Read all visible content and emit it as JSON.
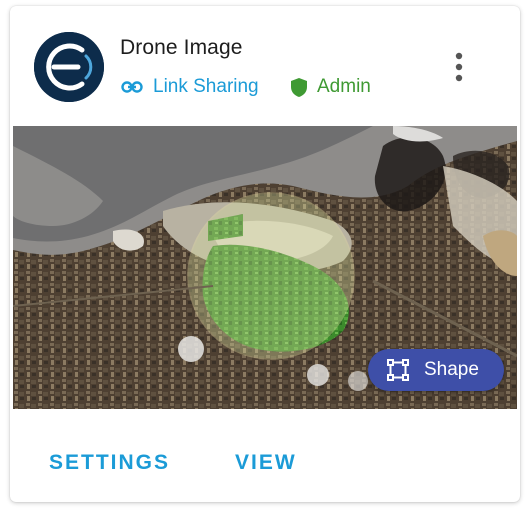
{
  "card": {
    "title": "Drone Image",
    "avatar_icon": "app-logo-e-icon",
    "link_sharing": {
      "icon": "link-icon",
      "label": "Link Sharing",
      "color": "#1b9bd7"
    },
    "role": {
      "icon": "shield-icon",
      "label": "Admin",
      "color": "#3f9a33"
    },
    "menu_icon": "more-vertical-icon"
  },
  "media": {
    "content": "satellite-map",
    "overlay_color": "#3fae2a",
    "shape_button": {
      "icon": "polygon-shape-icon",
      "label": "Shape",
      "color": "#3e4fa8"
    }
  },
  "actions": {
    "settings_label": "SETTINGS",
    "view_label": "VIEW",
    "color": "#1b9bd7"
  }
}
